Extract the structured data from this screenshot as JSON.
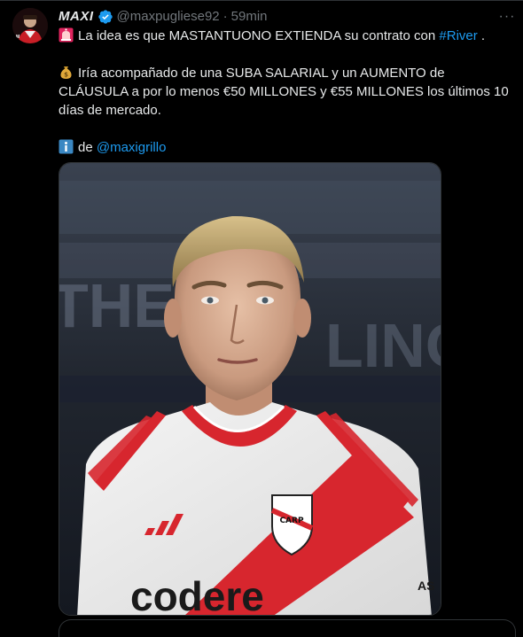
{
  "author": {
    "display_name": "MAXI",
    "handle": "@maxpugliese92",
    "separator": "·",
    "time": "59min",
    "avatar_icon": "profile-avatar",
    "verified_icon": "verified-badge-icon"
  },
  "menu": {
    "more_label": "···"
  },
  "tweet": {
    "line1": {
      "icon": "siren-icon",
      "text": "La idea es que MASTANTUONO EXTIENDA su contrato con ",
      "hashtag": "#River",
      "after": " ."
    },
    "line2": {
      "icon": "money-bag-icon",
      "text": "Iría acompañado de una SUBA SALARIAL y un AUMENTO de CLÁUSULA a por lo menos €50 MILLONES y €55 MILLONES los últimos 10 días de mercado."
    },
    "line3": {
      "icon": "information-icon",
      "text": "de ",
      "mention": "@maxigrillo"
    }
  },
  "media": {
    "kit_sponsor": "codere",
    "kit_sleeve": "AS",
    "crest_letters": "CARP",
    "background_text": "THE",
    "background_text_2": "LINO"
  },
  "colors": {
    "background": "#000000",
    "text": "#e7e9ea",
    "muted": "#71767b",
    "link": "#1d9bf0",
    "verified": "#1d9bf0",
    "kit_red": "#d7262e"
  }
}
